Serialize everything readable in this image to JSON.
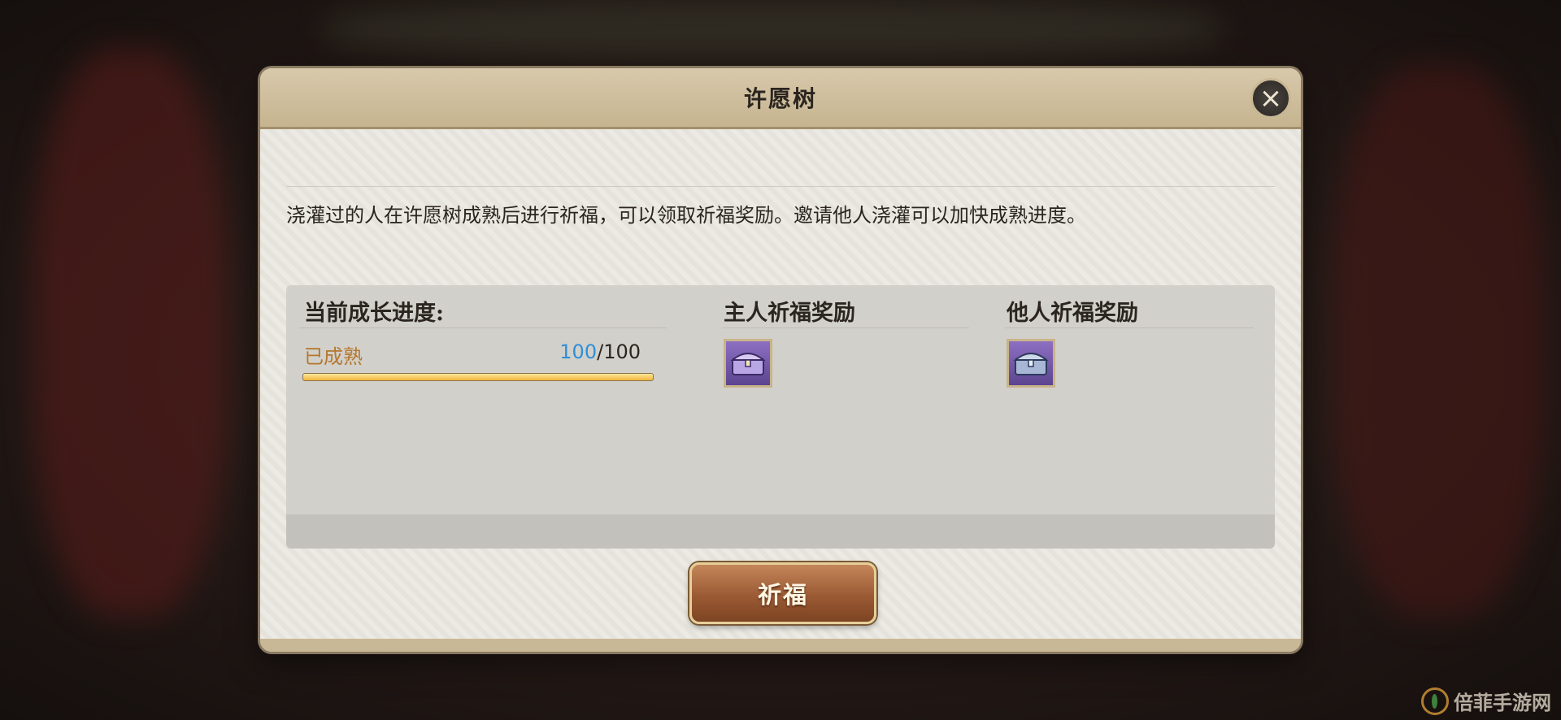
{
  "dialog": {
    "title": "许愿树",
    "close_icon": "close-x-icon",
    "description": "浇灌过的人在许愿树成熟后进行祈福，可以领取祈福奖励。邀请他人浇灌可以加快成熟进度。"
  },
  "progress": {
    "heading": "当前成长进度:",
    "status": "已成熟",
    "current": "100",
    "separator": "/",
    "max": "100",
    "fill_fraction": 1.0
  },
  "owner_reward": {
    "heading": "主人祈福奖励",
    "item_icon": "purple-chest-icon"
  },
  "other_reward": {
    "heading": "他人祈福奖励",
    "item_icon": "silver-chest-icon"
  },
  "pray_button": {
    "label": "祈福"
  },
  "watermark": {
    "text": "倍菲手游网"
  },
  "colors": {
    "status_orange": "#b4772e",
    "progress_blue": "#2f8fd9",
    "bar_gold": "#f0b43c",
    "button_brown": "#9b5a34"
  }
}
